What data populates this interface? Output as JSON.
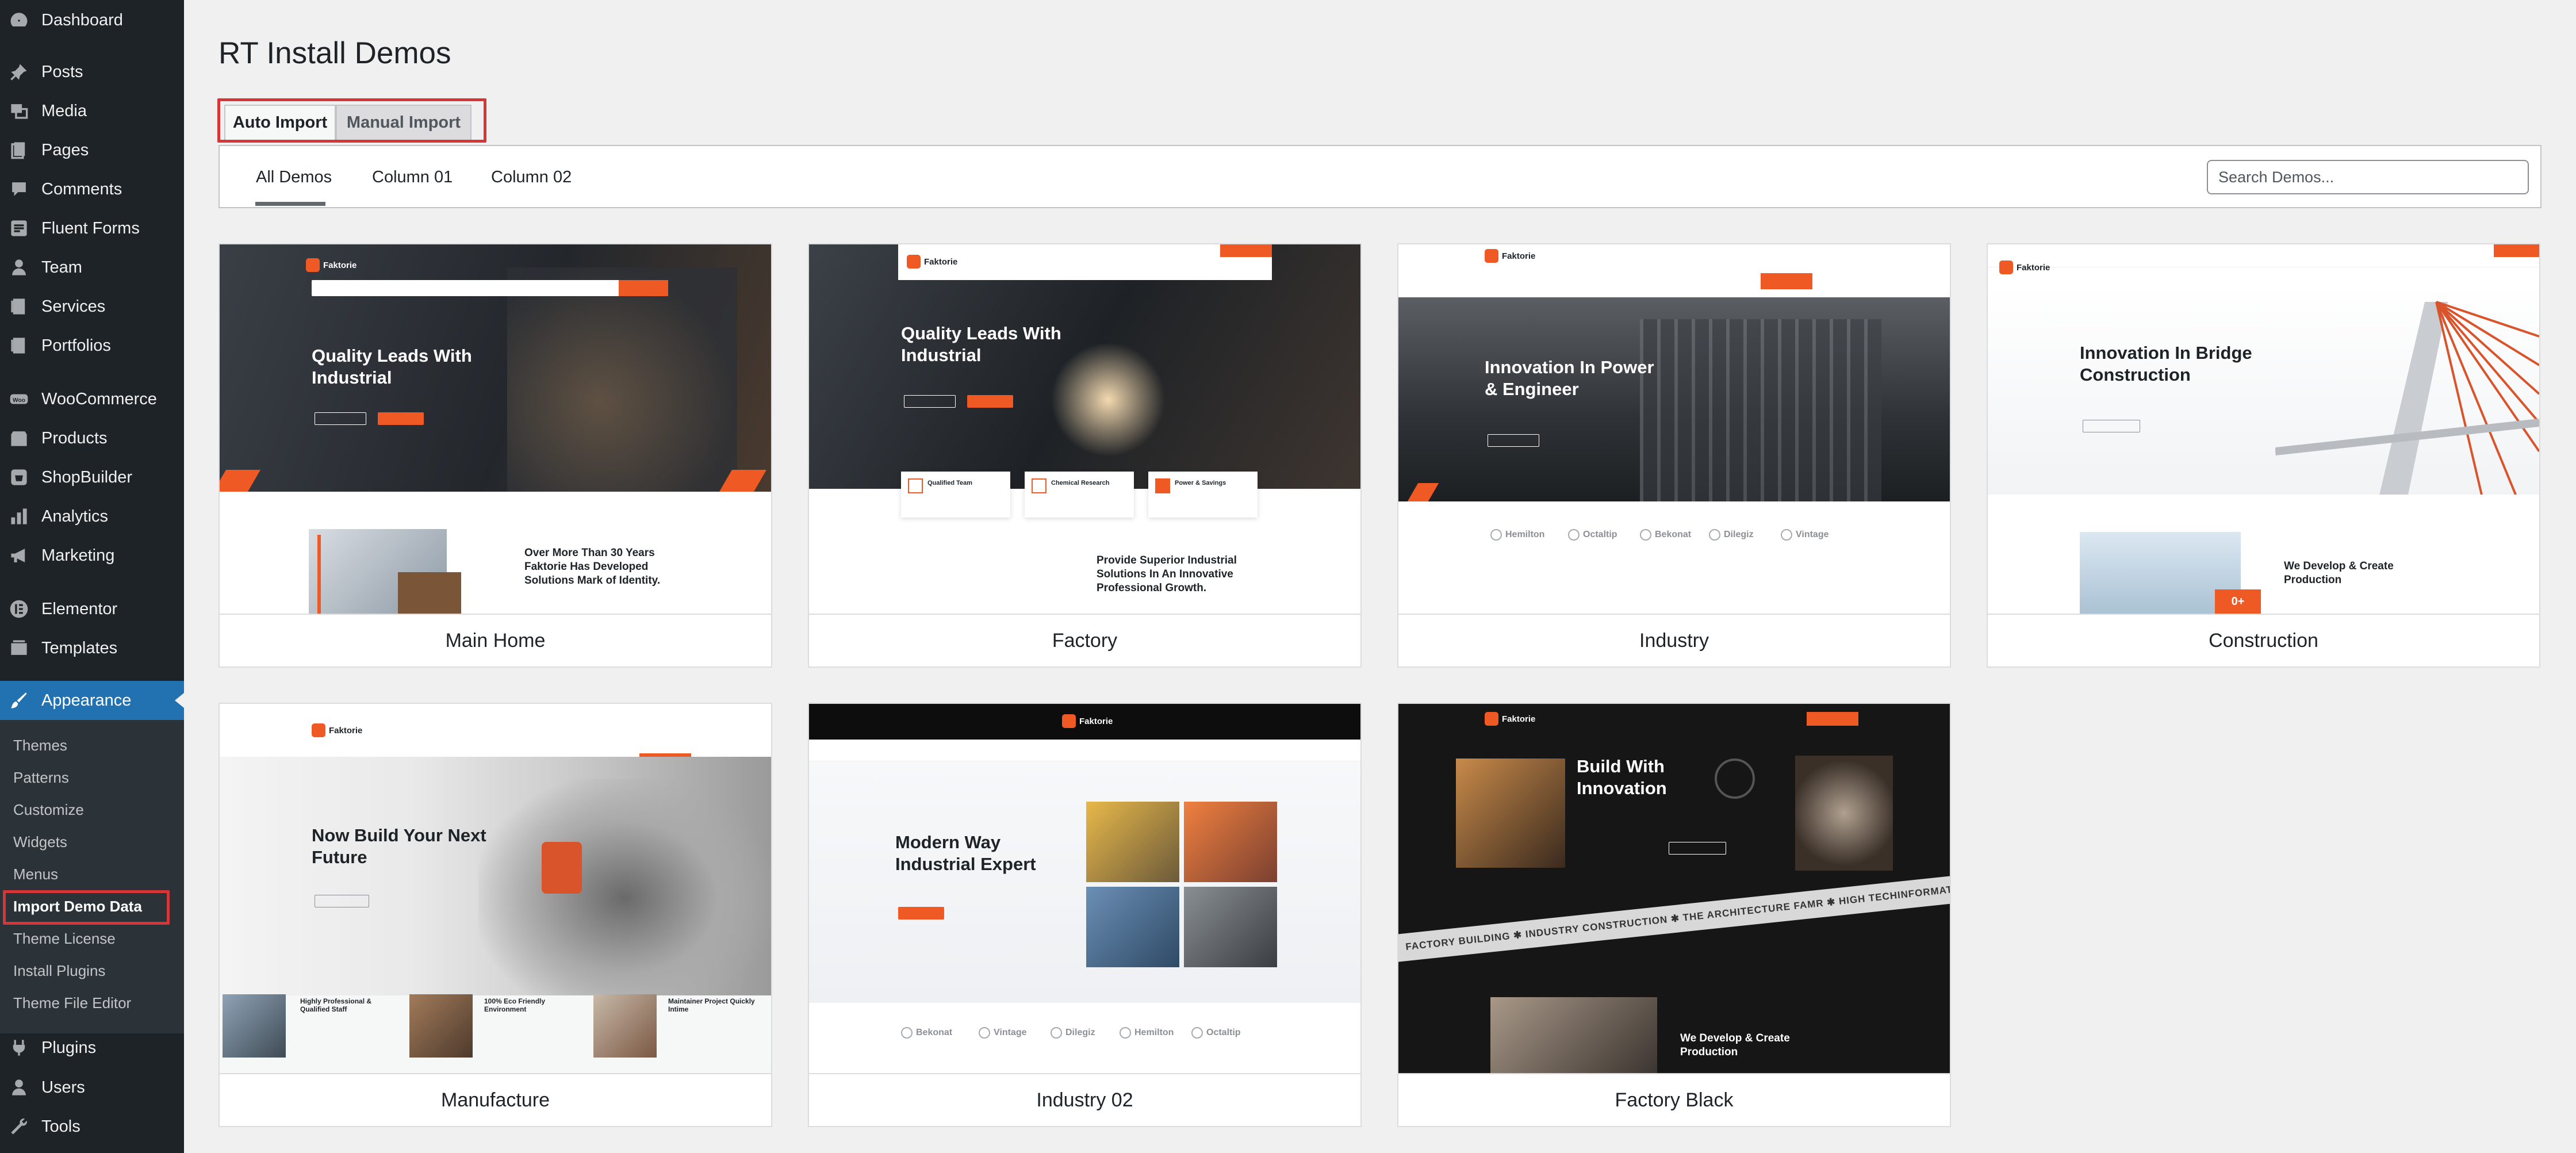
{
  "sidebar": {
    "items": [
      {
        "label": "Dashboard",
        "icon": "dashboard-icon"
      },
      {
        "label": "Posts",
        "icon": "pin-icon"
      },
      {
        "label": "Media",
        "icon": "media-icon"
      },
      {
        "label": "Pages",
        "icon": "pages-icon"
      },
      {
        "label": "Comments",
        "icon": "comment-icon"
      },
      {
        "label": "Fluent Forms",
        "icon": "forms-icon"
      },
      {
        "label": "Team",
        "icon": "team-icon"
      },
      {
        "label": "Services",
        "icon": "services-icon"
      },
      {
        "label": "Portfolios",
        "icon": "portfolio-icon"
      },
      {
        "label": "WooCommerce",
        "icon": "woo-icon"
      },
      {
        "label": "Products",
        "icon": "products-icon"
      },
      {
        "label": "ShopBuilder",
        "icon": "shopbuilder-icon"
      },
      {
        "label": "Analytics",
        "icon": "analytics-icon"
      },
      {
        "label": "Marketing",
        "icon": "megaphone-icon"
      },
      {
        "label": "Elementor",
        "icon": "elementor-icon"
      },
      {
        "label": "Templates",
        "icon": "templates-icon"
      },
      {
        "label": "Appearance",
        "icon": "brush-icon"
      },
      {
        "label": "Plugins",
        "icon": "plug-icon"
      },
      {
        "label": "Users",
        "icon": "user-icon"
      },
      {
        "label": "Tools",
        "icon": "wrench-icon"
      }
    ],
    "appearance_sub": [
      {
        "label": "Themes"
      },
      {
        "label": "Patterns"
      },
      {
        "label": "Customize"
      },
      {
        "label": "Widgets"
      },
      {
        "label": "Menus"
      },
      {
        "label": "Import Demo Data"
      },
      {
        "label": "Theme License"
      },
      {
        "label": "Install Plugins"
      },
      {
        "label": "Theme File Editor"
      }
    ]
  },
  "main": {
    "title": "RT Install Demos",
    "import_tabs": [
      {
        "label": "Auto Import"
      },
      {
        "label": "Manual Import"
      }
    ],
    "filter_tabs": [
      {
        "label": "All Demos"
      },
      {
        "label": "Column 01"
      },
      {
        "label": "Column 02"
      }
    ],
    "search_placeholder": "Search Demos..."
  },
  "demos": [
    {
      "name": "Main Home",
      "logo": "Faktorie",
      "hero": "Quality Leads With Industrial",
      "body": "Over More Than 30 Years Faktorie Has Developed Solutions Mark of Identity."
    },
    {
      "name": "Factory",
      "logo": "Faktorie",
      "hero": "Quality Leads With Industrial",
      "features": [
        "Qualified Team",
        "Chemical Research",
        "Power & Savings"
      ],
      "body": "Provide Superior Industrial Solutions In An Innovative Professional Growth."
    },
    {
      "name": "Industry",
      "logo": "Faktorie",
      "hero": "Innovation In Power & Engineer",
      "brands": [
        "Hemilton",
        "Octaltip",
        "Bekonat",
        "Dilegiz",
        "Vintage"
      ]
    },
    {
      "name": "Construction",
      "logo": "Faktorie",
      "hero": "Innovation In Bridge Construction",
      "body": "We Develop & Create Production",
      "badge": "0+"
    },
    {
      "name": "Manufacture",
      "logo": "Faktorie",
      "hero": "Now Build Your Next Future",
      "features": [
        "Highly Professional & Qualified Staff",
        "100% Eco Friendly Environment",
        "Maintainer Project Quickly Intime"
      ]
    },
    {
      "name": "Industry 02",
      "logo": "Faktorie",
      "hero": "Modern Way Industrial Expert",
      "brands": [
        "Bekonat",
        "Vintage",
        "Dilegiz",
        "Hemilton",
        "Octaltip"
      ]
    },
    {
      "name": "Factory Black",
      "logo": "Faktorie",
      "hero": "Build With Innovation",
      "ticker": "FACTORY BUILDING ✱ INDUSTRY CONSTRUCTION ✱ THE ARCHITECTURE FAMR ✱ HIGH TECHINFORMATION",
      "body": "We Develop & Create Production"
    }
  ],
  "colors": {
    "accent": "#ef5a24",
    "wp_blue": "#2271b1",
    "sidebar_bg": "#1d2327",
    "highlight": "#d63638"
  }
}
